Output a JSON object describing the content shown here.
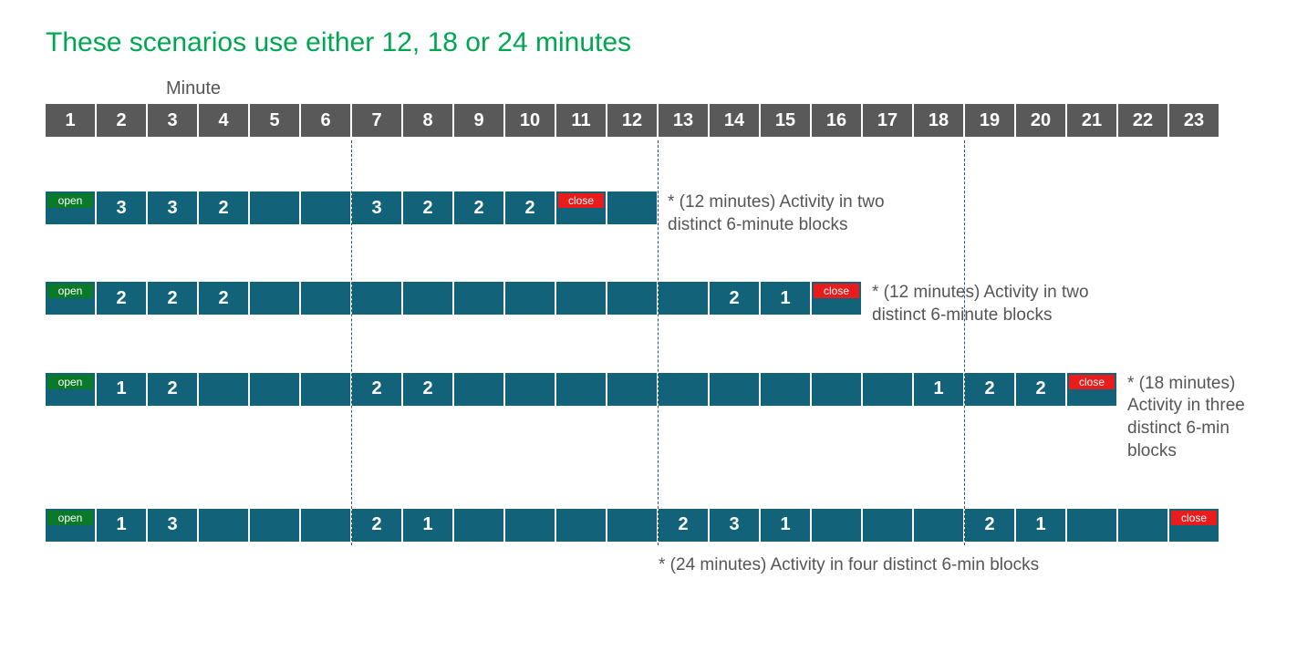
{
  "title": "These scenarios use either 12, 18 or 24 minutes",
  "axis": {
    "label": "Minute",
    "ticks": [
      "1",
      "2",
      "3",
      "4",
      "5",
      "6",
      "7",
      "8",
      "9",
      "10",
      "11",
      "12",
      "13",
      "14",
      "15",
      "16",
      "17",
      "18",
      "19",
      "20",
      "21",
      "22",
      "23"
    ]
  },
  "badges": {
    "open": "open",
    "close": "close"
  },
  "guides": [
    6,
    12,
    18
  ],
  "row1": {
    "len": 12,
    "open_at": 1,
    "close_at": 11,
    "values": {
      "2": "3",
      "3": "3",
      "4": "2",
      "7": "3",
      "8": "2",
      "9": "2",
      "10": "2"
    },
    "note": "* (12 minutes) Activity in two distinct 6-minute blocks"
  },
  "row2": {
    "len": 16,
    "open_at": 1,
    "close_at": 16,
    "values": {
      "2": "2",
      "3": "2",
      "4": "2",
      "14": "2",
      "15": "1"
    },
    "note": "* (12 minutes) Activity in two distinct 6-minute blocks"
  },
  "row3": {
    "len": 21,
    "open_at": 1,
    "close_at": 21,
    "values": {
      "2": "1",
      "3": "2",
      "7": "2",
      "8": "2",
      "18": "1",
      "19": "2",
      "20": "2"
    },
    "note": "* (18 minutes) Activity in three distinct 6-min blocks"
  },
  "row4": {
    "len": 23,
    "open_at": 1,
    "close_at": 23,
    "values": {
      "2": "1",
      "3": "3",
      "7": "2",
      "8": "1",
      "13": "2",
      "14": "3",
      "15": "1",
      "19": "2",
      "20": "1"
    },
    "note": "* (24 minutes) Activity in four distinct 6-min blocks"
  }
}
